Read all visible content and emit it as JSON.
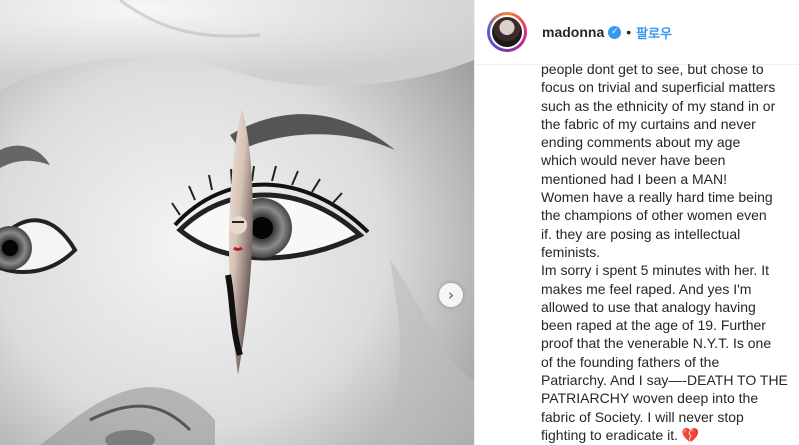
{
  "post": {
    "username": "madonna",
    "verified_icon": "verified-badge-icon",
    "separator": "•",
    "follow_label": "팔로우",
    "caption_lines": [
      "people dont get to see, but chose to",
      "focus on trivial and superficial matters",
      "such as the ethnicity of my stand in or",
      "the fabric of my curtains and never",
      "ending comments about my age",
      "which would never have been",
      "mentioned had I been a MAN!",
      "Women have a really hard time being",
      "the champions of other women even",
      "if. they are posing as intellectual",
      "feminists.",
      "Im sorry i spent 5 minutes with her. It",
      "makes me feel raped. And yes I'm",
      "allowed to use that analogy having",
      "been raped at the age of 19. Further",
      "proof that the venerable N.Y.T. Is one",
      "of the founding fathers of the",
      "Patriarchy. And I say—-DEATH TO THE",
      "PATRIARCHY woven deep into the",
      "fabric of Society. I will never stop",
      "fighting to eradicate it. 💔"
    ]
  },
  "media": {
    "next_icon": "chevron-right-icon",
    "next_glyph": "›"
  },
  "colors": {
    "text": "#262626",
    "link_blue": "#3897f0",
    "divider": "#efefef"
  }
}
